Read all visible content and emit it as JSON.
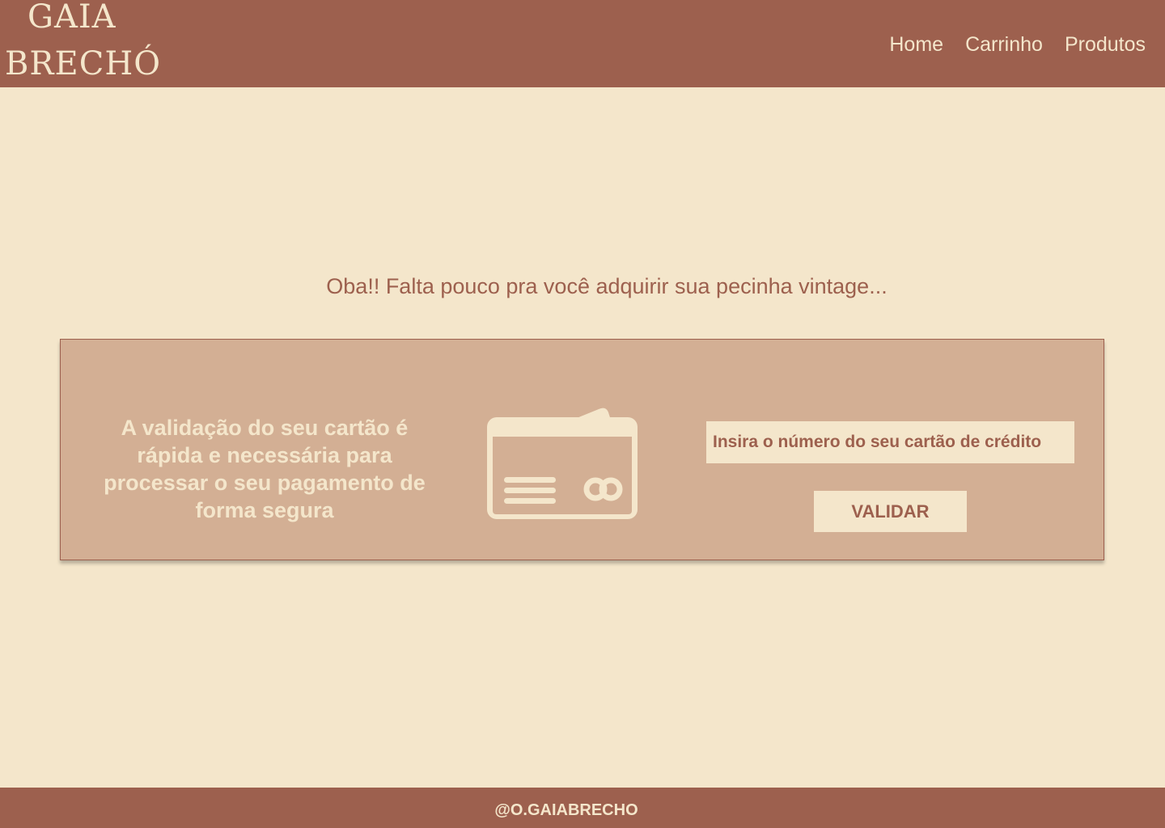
{
  "header": {
    "logo_line1": "GAIA",
    "logo_line2": "BRECHÓ",
    "nav": {
      "home": "Home",
      "cart": "Carrinho",
      "products": "Produtos"
    }
  },
  "main": {
    "headline": "Oba!! Falta pouco pra você adquirir sua pecinha vintage...",
    "panel": {
      "description": "A validação do seu cartão é rápida e necessária para processar o seu pagamento de forma segura",
      "card_icon": "credit-card-icon",
      "input_placeholder": "Insira o número do seu cartão de crédito",
      "input_value": "",
      "validate_label": "VALIDAR"
    }
  },
  "footer": {
    "handle": "@O.GAIABRECHO"
  },
  "colors": {
    "brand": "#9D604E",
    "background": "#F4E6CB",
    "panel": "#D3AF94"
  }
}
